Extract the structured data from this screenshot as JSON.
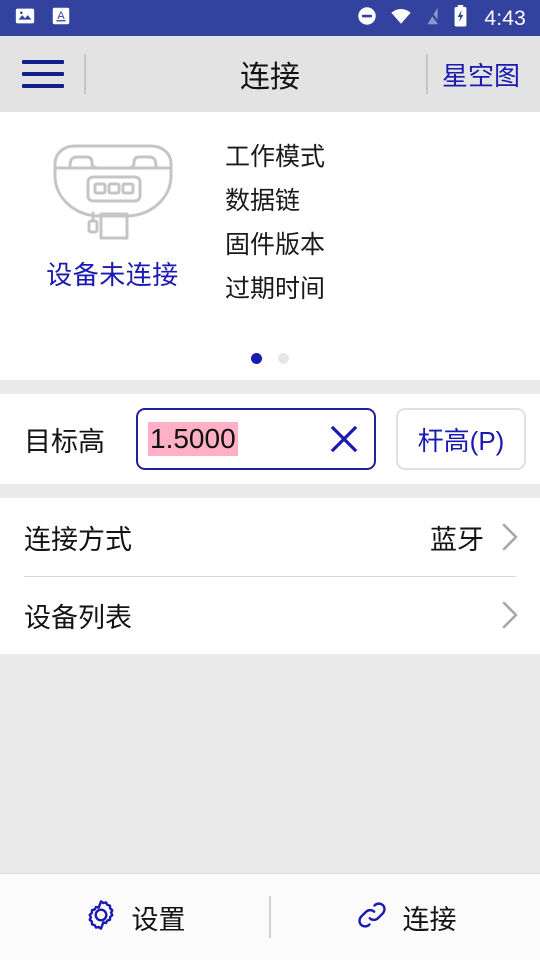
{
  "statusbar": {
    "time": "4:43",
    "icons": [
      "image-icon",
      "screenshot-icon",
      "do-not-disturb-icon",
      "wifi-icon",
      "signal-off-icon",
      "battery-charging-icon"
    ],
    "background": "#33429F"
  },
  "header": {
    "menu_icon": "hamburger-menu-icon",
    "title": "连接",
    "right_link": "星空图"
  },
  "device": {
    "icon": "gnss-receiver-icon",
    "status": "设备未连接",
    "info_rows": [
      "工作模式",
      "数据链",
      "固件版本",
      "过期时间"
    ],
    "pager": {
      "count": 2,
      "active_index": 0
    }
  },
  "target_height": {
    "label": "目标高",
    "value": "1.5000",
    "placeholder": "",
    "clear_icon": "close-x-icon",
    "pole_button": "杆高(P)",
    "selection_color": "#FFB0C6",
    "focus_border": "#2020A0"
  },
  "list": [
    {
      "label": "连接方式",
      "value": "蓝牙",
      "chevron": "chevron-right-icon"
    },
    {
      "label": "设备列表",
      "value": "",
      "chevron": "chevron-right-icon"
    }
  ],
  "bottom_bar": {
    "settings": {
      "icon": "gear-icon",
      "label": "设置"
    },
    "connect": {
      "icon": "link-chain-icon",
      "label": "连接"
    }
  },
  "accent_color": "#1A1AB0"
}
